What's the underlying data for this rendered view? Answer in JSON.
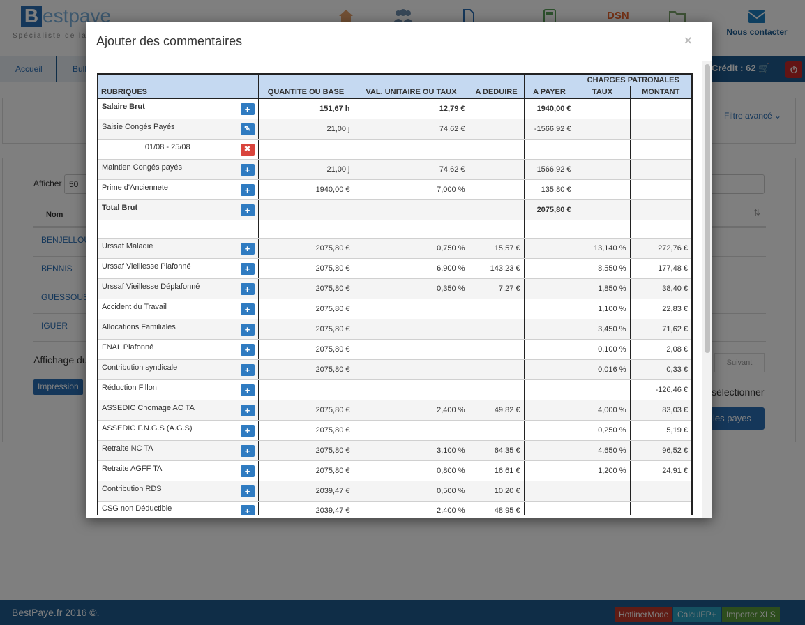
{
  "app": {
    "logo_letter": "B",
    "logo_rest": "estpaye",
    "tagline": "Spécialiste de la p",
    "contact_label": "Nous contacter",
    "credit": "Crédit : 62",
    "breadcrumb": [
      "Accueil",
      "Bulle"
    ],
    "filter_label": "Filtre avancé",
    "show_label": "Afficher",
    "show_value": "50",
    "table_col": "Nom",
    "rows": [
      "BENJELLOU",
      "BENNIS",
      "GUESSOUS",
      "IGUER"
    ],
    "paging_label": "Affichage du",
    "print_label": "Impression",
    "next_label": "Suivant",
    "select_label": "sélectionner",
    "payes_label": "les payes",
    "footer_text": "BestPaye.fr 2016 ©.",
    "footer_buttons": [
      "HotlinerMode",
      "CalculFP+",
      "Importer XLS"
    ],
    "dsn_label": "DSN"
  },
  "modal": {
    "title": "Ajouter des commentaires",
    "close": "×",
    "headers": {
      "rubriques": "RUBRIQUES",
      "quantite": "QUANTITE OU BASE",
      "val_unitaire": "VAL. UNITAIRE OU TAUX",
      "a_deduire": "A DEDUIRE",
      "a_payer": "A PAYER",
      "charges": "CHARGES PATRONALES",
      "taux": "TAUX",
      "montant": "MONTANT"
    },
    "rows": [
      {
        "label": "Salaire Brut",
        "bold": true,
        "icon": "plus",
        "qte": "151,67 h",
        "val": "12,79 €",
        "ded": "",
        "pay": "1940,00 €",
        "taux": "",
        "mont": ""
      },
      {
        "label": "Saisie Congés Payés",
        "bold": false,
        "icon": "edit",
        "qte": "21,00 j",
        "val": "74,62 €",
        "ded": "",
        "pay": "-1566,92 €",
        "taux": "",
        "mont": ""
      },
      {
        "label": "01/08 - 25/08",
        "bold": false,
        "icon": "delete",
        "center": true,
        "qte": "",
        "val": "",
        "ded": "",
        "pay": "",
        "taux": "",
        "mont": ""
      },
      {
        "label": "Maintien Congés payés",
        "bold": false,
        "icon": "plus",
        "qte": "21,00 j",
        "val": "74,62 €",
        "ded": "",
        "pay": "1566,92 €",
        "taux": "",
        "mont": ""
      },
      {
        "label": "Prime d'Anciennete",
        "bold": false,
        "icon": "plus",
        "qte": "1940,00 €",
        "val": "7,000 %",
        "ded": "",
        "pay": "135,80 €",
        "taux": "",
        "mont": ""
      },
      {
        "label": "Total Brut",
        "bold": true,
        "icon": "plus",
        "qte": "",
        "val": "",
        "ded": "",
        "pay": "2075,80 €",
        "taux": "",
        "mont": ""
      },
      {
        "label": "",
        "bold": false,
        "icon": "",
        "qte": "",
        "val": "",
        "ded": "",
        "pay": "",
        "taux": "",
        "mont": ""
      },
      {
        "label": "Urssaf Maladie",
        "bold": false,
        "icon": "plus",
        "qte": "2075,80 €",
        "val": "0,750 %",
        "ded": "15,57 €",
        "pay": "",
        "taux": "13,140 %",
        "mont": "272,76 €"
      },
      {
        "label": "Urssaf Vieillesse Plafonné",
        "bold": false,
        "icon": "plus",
        "qte": "2075,80 €",
        "val": "6,900 %",
        "ded": "143,23 €",
        "pay": "",
        "taux": "8,550 %",
        "mont": "177,48 €"
      },
      {
        "label": "Urssaf Vieillesse Déplafonné",
        "bold": false,
        "icon": "plus",
        "qte": "2075,80 €",
        "val": "0,350 %",
        "ded": "7,27 €",
        "pay": "",
        "taux": "1,850 %",
        "mont": "38,40 €"
      },
      {
        "label": "Accident du Travail",
        "bold": false,
        "icon": "plus",
        "qte": "2075,80 €",
        "val": "",
        "ded": "",
        "pay": "",
        "taux": "1,100 %",
        "mont": "22,83 €"
      },
      {
        "label": "Allocations Familiales",
        "bold": false,
        "icon": "plus",
        "qte": "2075,80 €",
        "val": "",
        "ded": "",
        "pay": "",
        "taux": "3,450 %",
        "mont": "71,62 €"
      },
      {
        "label": "FNAL Plafonné",
        "bold": false,
        "icon": "plus",
        "qte": "2075,80 €",
        "val": "",
        "ded": "",
        "pay": "",
        "taux": "0,100 %",
        "mont": "2,08 €"
      },
      {
        "label": "Contribution syndicale",
        "bold": false,
        "icon": "plus",
        "qte": "2075,80 €",
        "val": "",
        "ded": "",
        "pay": "",
        "taux": "0,016 %",
        "mont": "0,33 €"
      },
      {
        "label": "Réduction Fillon",
        "bold": false,
        "icon": "plus",
        "qte": "",
        "val": "",
        "ded": "",
        "pay": "",
        "taux": "",
        "mont": "-126,46 €"
      },
      {
        "label": "ASSEDIC Chomage AC TA",
        "bold": false,
        "icon": "plus",
        "qte": "2075,80 €",
        "val": "2,400 %",
        "ded": "49,82 €",
        "pay": "",
        "taux": "4,000 %",
        "mont": "83,03 €"
      },
      {
        "label": "ASSEDIC F.N.G.S (A.G.S)",
        "bold": false,
        "icon": "plus",
        "qte": "2075,80 €",
        "val": "",
        "ded": "",
        "pay": "",
        "taux": "0,250 %",
        "mont": "5,19 €"
      },
      {
        "label": "Retraite NC TA",
        "bold": false,
        "icon": "plus",
        "qte": "2075,80 €",
        "val": "3,100 %",
        "ded": "64,35 €",
        "pay": "",
        "taux": "4,650 %",
        "mont": "96,52 €"
      },
      {
        "label": "Retraite AGFF TA",
        "bold": false,
        "icon": "plus",
        "qte": "2075,80 €",
        "val": "0,800 %",
        "ded": "16,61 €",
        "pay": "",
        "taux": "1,200 %",
        "mont": "24,91 €"
      },
      {
        "label": "Contribution RDS",
        "bold": false,
        "icon": "plus",
        "qte": "2039,47 €",
        "val": "0,500 %",
        "ded": "10,20 €",
        "pay": "",
        "taux": "",
        "mont": ""
      },
      {
        "label": "CSG non Déductible",
        "bold": false,
        "icon": "plus",
        "qte": "2039,47 €",
        "val": "2,400 %",
        "ded": "48,95 €",
        "pay": "",
        "taux": "",
        "mont": ""
      }
    ]
  },
  "colors": {
    "header_blue": "#c5d9f1",
    "brand_blue": "#1f5b8f",
    "link_blue": "#2a6eb5",
    "plus_button": "#2f7bc1",
    "delete_button": "#d9443c"
  }
}
